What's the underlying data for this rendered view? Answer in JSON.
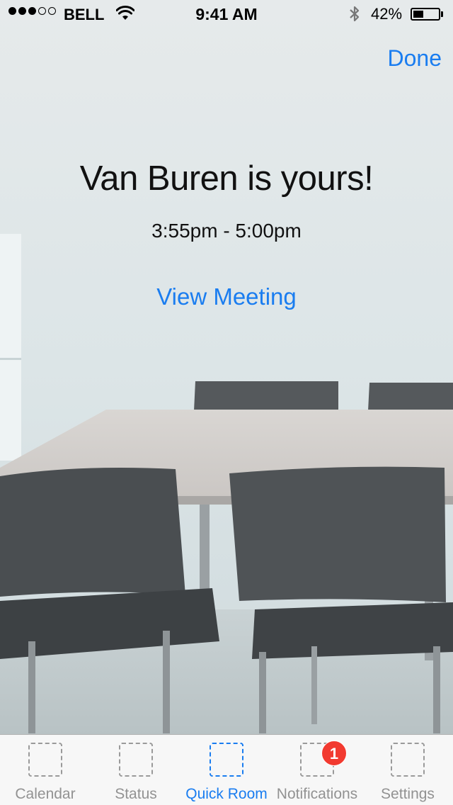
{
  "status_bar": {
    "signal_dots": [
      true,
      true,
      true,
      false,
      false
    ],
    "carrier": "BELL",
    "time": "9:41 AM",
    "battery_percent_label": "42%",
    "battery_level": 0.42
  },
  "header": {
    "done_label": "Done"
  },
  "booking": {
    "headline": "Van Buren is yours!",
    "time_range": "3:55pm - 5:00pm",
    "view_meeting_label": "View Meeting"
  },
  "tab_bar": {
    "active_index": 2,
    "tabs": [
      {
        "label": "Calendar",
        "icon": "calendar-icon",
        "badge": null
      },
      {
        "label": "Status",
        "icon": "status-icon",
        "badge": null
      },
      {
        "label": "Quick Room",
        "icon": "quick-room-icon",
        "badge": null
      },
      {
        "label": "Notifications",
        "icon": "notifications-icon",
        "badge": "1"
      },
      {
        "label": "Settings",
        "icon": "settings-icon",
        "badge": null
      }
    ]
  },
  "colors": {
    "accent": "#1a7df0",
    "badge": "#f23a30",
    "tab_inactive": "#929292"
  }
}
